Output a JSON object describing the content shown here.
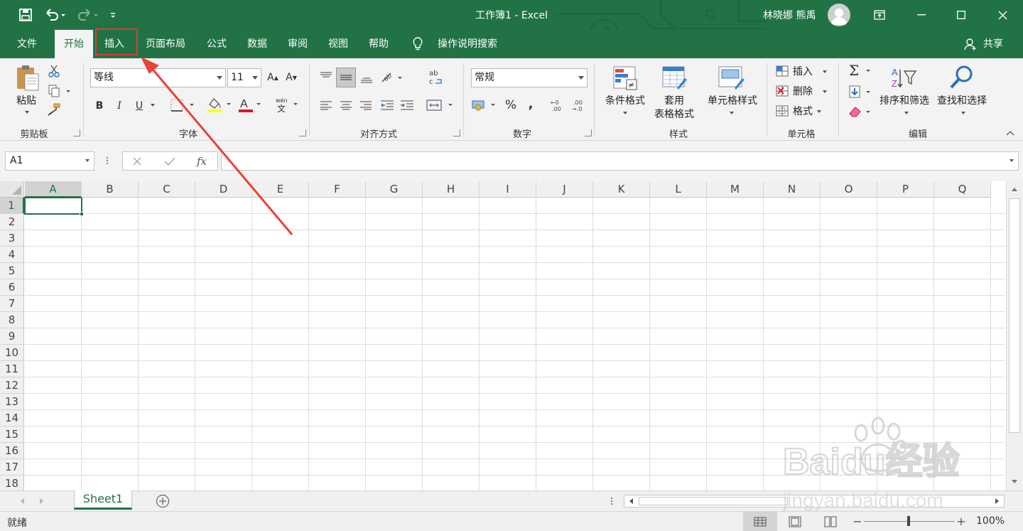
{
  "app": {
    "title": "工作簿1  -  Excel",
    "user": "林晓娜 熊禹",
    "accent": "#217346"
  },
  "tabs": [
    {
      "label": "文件"
    },
    {
      "label": "开始"
    },
    {
      "label": "插入"
    },
    {
      "label": "页面布局"
    },
    {
      "label": "公式"
    },
    {
      "label": "数据"
    },
    {
      "label": "审阅"
    },
    {
      "label": "视图"
    },
    {
      "label": "帮助"
    }
  ],
  "tell_me": "操作说明搜索",
  "share": "共享",
  "ribbon": {
    "clipboard": {
      "label": "剪贴板",
      "paste": "粘贴"
    },
    "font": {
      "label": "字体",
      "name": "等线",
      "size": "11",
      "bold": "B",
      "italic": "I",
      "underline": "U"
    },
    "alignment": {
      "label": "对齐方式"
    },
    "number": {
      "label": "数字",
      "format": "常规",
      "percent": "%",
      "comma": ","
    },
    "styles": {
      "label": "样式",
      "conditional": "条件格式",
      "table_line1": "套用",
      "table_line2": "表格格式",
      "cell_styles": "单元格样式"
    },
    "cells": {
      "label": "单元格",
      "insert": "插入",
      "delete": "删除",
      "format": "格式"
    },
    "editing": {
      "label": "编辑",
      "sort": "排序和筛选",
      "find": "查找和选择"
    }
  },
  "formula_bar": {
    "name_box": "A1",
    "fx": "fx",
    "formula": ""
  },
  "columns": [
    "A",
    "B",
    "C",
    "D",
    "E",
    "F",
    "G",
    "H",
    "I",
    "J",
    "K",
    "L",
    "M",
    "N",
    "O",
    "P",
    "Q"
  ],
  "rows": [
    "1",
    "2",
    "3",
    "4",
    "5",
    "6",
    "7",
    "8",
    "9",
    "10",
    "11",
    "12",
    "13",
    "14",
    "15",
    "16",
    "17",
    "18"
  ],
  "active_cell": "A1",
  "sheets": [
    {
      "name": "Sheet1"
    }
  ],
  "status": {
    "mode": "就绪",
    "zoom": "100%"
  },
  "watermark": {
    "brand": "Baidu经验",
    "url": "jingyan.baidu.com"
  }
}
